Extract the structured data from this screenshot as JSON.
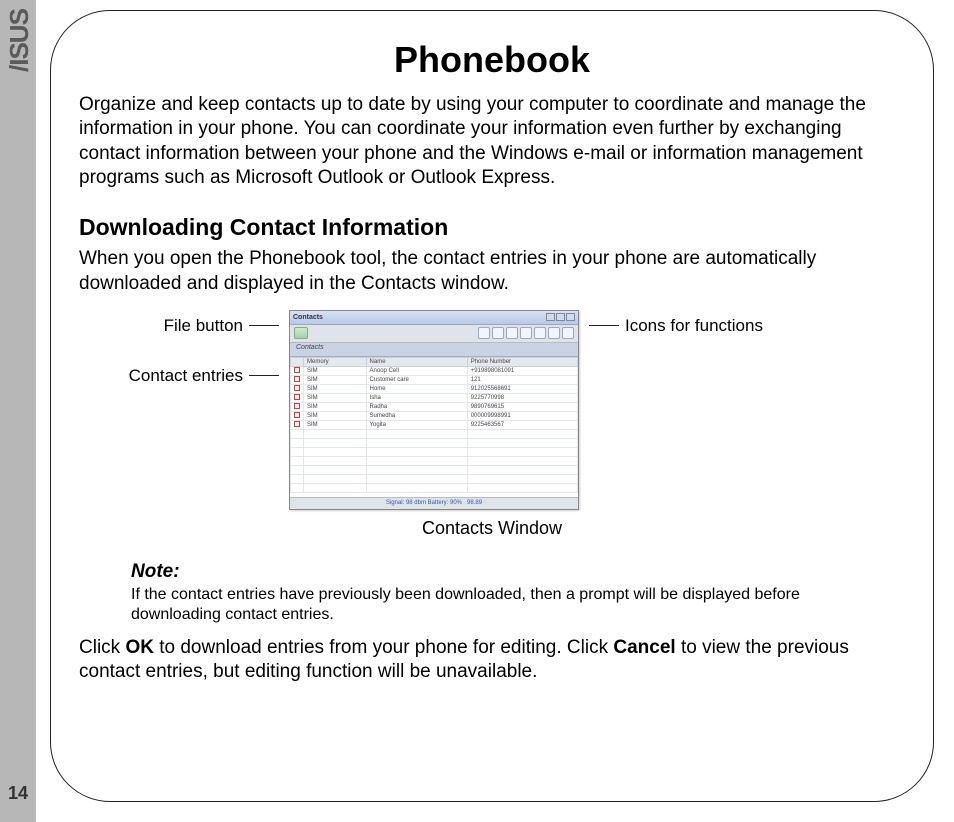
{
  "logo_text": "/ISUS",
  "page_number": "14",
  "title": "Phonebook",
  "intro": "Organize and keep contacts up to date by using your computer to coordinate and manage the information in your phone. You can coordinate your information even further by exchanging contact information between your phone and the Windows e-mail or information management programs such as Microsoft Outlook or Outlook Express.",
  "section_heading": "Downloading Contact Information",
  "section_text": "When you open the Phonebook tool, the contact entries in your phone are automatically downloaded and displayed in the Contacts window.",
  "labels": {
    "file_button": "File button",
    "contact_entries": "Contact entries",
    "icons_for_functions": "Icons for functions",
    "caption": "Contacts Window"
  },
  "screenshot": {
    "window_title": "Contacts",
    "tab_label": "Contacts",
    "columns": [
      "",
      "Memory",
      "Name",
      "Phone Number"
    ],
    "rows": [
      {
        "mem": "SIM",
        "name": "Anoop Cell",
        "num": "+919898081091"
      },
      {
        "mem": "SIM",
        "name": "Customer care",
        "num": "121"
      },
      {
        "mem": "SIM",
        "name": "Home",
        "num": "912025568691"
      },
      {
        "mem": "SIM",
        "name": "Isha",
        "num": "9225770998"
      },
      {
        "mem": "SIM",
        "name": "Radha",
        "num": "9890769615"
      },
      {
        "mem": "SIM",
        "name": "Sumedha",
        "num": "000009998991"
      },
      {
        "mem": "SIM",
        "name": "Yogita",
        "num": "9225463567"
      }
    ],
    "status_text": "Signal: 98 dbm Battery: 90%",
    "status_right": "98.89"
  },
  "note": {
    "heading": "Note:",
    "text": "If the contact entries have previously been downloaded, then a prompt will be displayed before downloading contact entries."
  },
  "closing": {
    "pre": "Click ",
    "ok": "OK",
    "mid": " to download entries from your phone for editing. Click ",
    "cancel": "Cancel",
    "post": " to view the previous contact entries, but editing function will be unavailable."
  }
}
